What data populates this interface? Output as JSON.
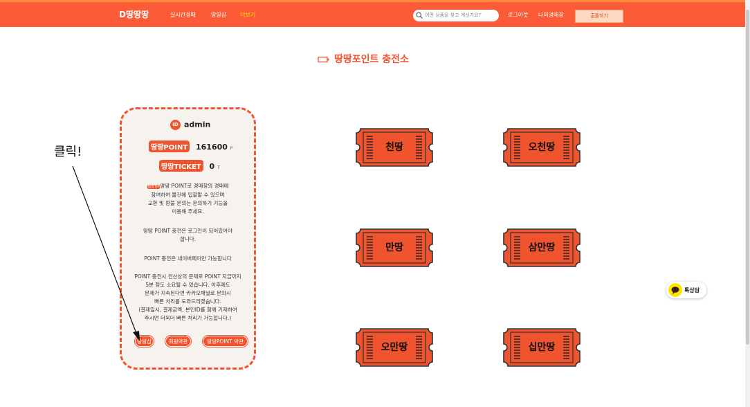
{
  "header": {
    "logo": "D땅땅땅",
    "nav": [
      "실시간경매",
      "땅땅샵",
      "더보기"
    ],
    "search_placeholder": "어떤 상품을 찾고 계신가요?",
    "logout": "로그아웃",
    "my_auction": "나의경매장",
    "auction_button": "출품하기"
  },
  "page": {
    "title": "땅땅포인트 충전소"
  },
  "card": {
    "id_badge": "ID",
    "user_id": "admin",
    "point_label": "땅땅POINT",
    "point_value": "161600",
    "point_unit": "P",
    "ticket_label": "땅땅TICKET",
    "ticket_value": "0",
    "ticket_unit": "T",
    "tip_badge": "땅땅TIP",
    "desc1_a": "땅땅 POINT로 경매장의 경매에",
    "desc1_b": "참여하여 물건에 입찰할 수 있으며",
    "desc1_c": "교환 및 환불 문의는 문의하기 기능을",
    "desc1_d": "이용해 주세요.",
    "desc2_a": "땅땅 POINT 충전은 로그인이 되어있어야",
    "desc2_b": "합니다.",
    "desc3": "POINT 충전은 네이버페이만 가능합니다",
    "desc4_a": "POINT 충전시 전산상의 문제로 POINT 지급까지",
    "desc4_b": "5분 정도 소요될 수 있습니다. 이후에도",
    "desc4_c": "문제가 지속된다면 카카오채널로 문의시",
    "desc4_d": "빠른 처리를 도와드리겠습니다.",
    "desc4_e": "(결제일시, 결제금액, 본인ID를 함께 기재하여",
    "desc4_f": "주시면 더욱더 빠른 처리가 가능합니다.)",
    "btn_shop": "땅땅샵",
    "btn_terms": "회원약관",
    "btn_point_terms": "땅땅POINT 약관"
  },
  "tickets": [
    "천땅",
    "오천땅",
    "만땅",
    "삼만땅",
    "오만땅",
    "십만땅"
  ],
  "annotation": "클릭!",
  "chat": {
    "label": "톡상담"
  },
  "colors": {
    "brand": "#fb5c37",
    "accent": "#f0542f",
    "highlight": "#ffe100",
    "kakao": "#fee500"
  }
}
